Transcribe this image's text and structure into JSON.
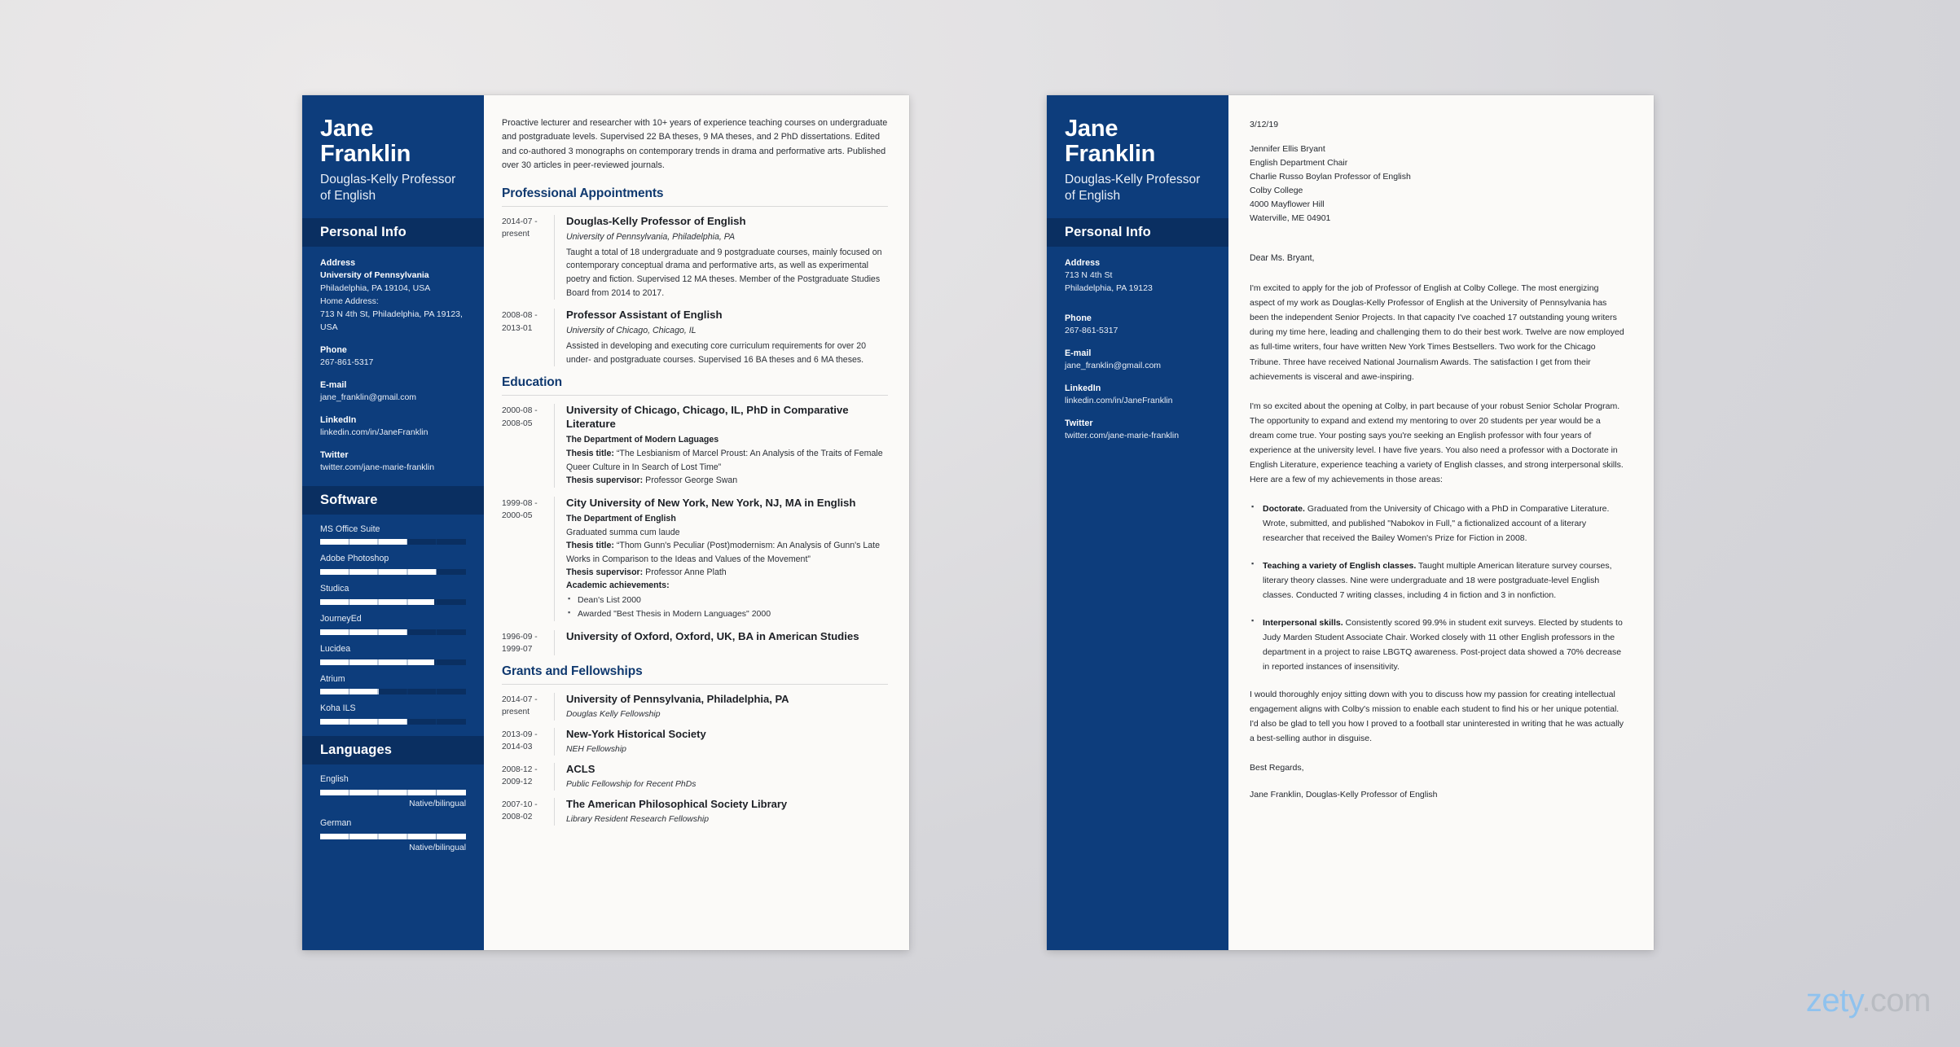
{
  "colors": {
    "sidebar": "#0d3d7c",
    "sidebar_head": "#0a2f61",
    "section_heading": "#10396f",
    "page": "#fbfaf8",
    "backdrop": "#d8d8dc",
    "watermark_accent": "#8fc2ee"
  },
  "resume": {
    "name": "Jane Franklin",
    "name_line1": "Jane",
    "name_line2": "Franklin",
    "job_title": "Douglas-Kelly Professor of English",
    "sections": {
      "personal_info": "Personal Info",
      "software": "Software",
      "languages": "Languages",
      "professional_appointments": "Professional Appointments",
      "education": "Education",
      "grants": "Grants and Fellowships"
    },
    "personal_info": {
      "address_label": "Address",
      "address_org": "University of Pennsylvania",
      "address_city": "Philadelphia, PA 19104, USA",
      "home_address_label": "Home Address:",
      "home_address_line1": "713 N 4th St, Philadelphia, PA 19123,",
      "home_address_line2": "USA",
      "phone_label": "Phone",
      "phone": "267-861-5317",
      "email_label": "E-mail",
      "email": "jane_franklin@gmail.com",
      "linkedin_label": "LinkedIn",
      "linkedin": "linkedin.com/in/JaneFranklin",
      "twitter_label": "Twitter",
      "twitter": "twitter.com/jane-marie-franklin"
    },
    "software": [
      {
        "name": "MS Office Suite",
        "level": 60
      },
      {
        "name": "Adobe Photoshop",
        "level": 80
      },
      {
        "name": "Studica",
        "level": 78
      },
      {
        "name": "JourneyEd",
        "level": 60
      },
      {
        "name": "Lucidea",
        "level": 78
      },
      {
        "name": "Atrium",
        "level": 40
      },
      {
        "name": "Koha ILS",
        "level": 60
      }
    ],
    "languages": [
      {
        "name": "English",
        "level": 100,
        "rating": "Native/bilingual"
      },
      {
        "name": "German",
        "level": 100,
        "rating": "Native/bilingual"
      }
    ],
    "summary": "Proactive lecturer and researcher with 10+ years of experience teaching courses on undergraduate and postgraduate levels. Supervised 22 BA theses, 9 MA theses, and 2 PhD dissertations. Edited and co-authored 3 monographs on contemporary trends in drama and performative arts. Published over 30 articles in peer-reviewed journals.",
    "appointments": [
      {
        "dates": "2014-07 - present",
        "title": "Douglas-Kelly Professor of English",
        "org": "University of Pennsylvania, Philadelphia, PA",
        "desc": "Taught a total of 18 undergraduate and 9 postgraduate courses, mainly focused on contemporary conceptual drama and performative arts, as well as experimental poetry and fiction. Supervised 12 MA theses. Member of the Postgraduate Studies Board from 2014 to 2017."
      },
      {
        "dates": "2008-08 - 2013-01",
        "title": "Professor Assistant of English",
        "org": "University of Chicago, Chicago, IL",
        "desc": "Assisted in developing and executing core curriculum requirements for over 20 under- and postgraduate courses. Supervised 16 BA theses and 6 MA theses."
      }
    ],
    "education": [
      {
        "dates": "2000-08 - 2008-05",
        "title": "University of Chicago, Chicago, IL, PhD in Comparative Literature",
        "department": "The Department of Modern Laguages",
        "thesis_title_label": "Thesis title:",
        "thesis_title": "“The Lesbianism of Marcel Proust: An Analysis of the Traits of Female Queer Culture in In Search of Lost Time”",
        "supervisor_label": "Thesis supervisor:",
        "supervisor": "Professor George Swan"
      },
      {
        "dates": "1999-08 - 2000-05",
        "title": "City University of New York, New York, NJ, MA in English",
        "department": "The Department of English",
        "honors": "Graduated summa cum laude",
        "thesis_title_label": "Thesis title:",
        "thesis_title": "“Thom Gunn's Peculiar (Post)modernism: An Analysis of Gunn's Late Works in Comparison to the Ideas and Values of the Movement”",
        "supervisor_label": "Thesis supervisor:",
        "supervisor": "Professor Anne Plath",
        "achievements_label": "Academic achievements:",
        "achievements": [
          "Dean's List 2000",
          "Awarded \"Best Thesis in Modern Languages\" 2000"
        ]
      },
      {
        "dates": "1996-09 - 1999-07",
        "title": "University of Oxford, Oxford, UK, BA in American Studies"
      }
    ],
    "grants": [
      {
        "dates": "2014-07 - present",
        "title": "University of Pennsylvania, Philadelphia, PA",
        "sub": "Douglas Kelly Fellowship"
      },
      {
        "dates": "2013-09 - 2014-03",
        "title": "New-York Historical Society",
        "sub": "NEH Fellowship"
      },
      {
        "dates": "2008-12 - 2009-12",
        "title": "ACLS",
        "sub": "Public Fellowship for Recent PhDs"
      },
      {
        "dates": "2007-10 - 2008-02",
        "title": "The American Philosophical Society Library",
        "sub": "Library Resident Research Fellowship"
      }
    ]
  },
  "letter": {
    "name_line1": "Jane",
    "name_line2": "Franklin",
    "job_title": "Douglas-Kelly Professor of English",
    "personal_info_heading": "Personal Info",
    "personal_info": {
      "address_label": "Address",
      "address_line1": "713 N 4th St",
      "address_line2": "Philadelphia, PA 19123",
      "phone_label": "Phone",
      "phone": "267-861-5317",
      "email_label": "E-mail",
      "email": "jane_franklin@gmail.com",
      "linkedin_label": "LinkedIn",
      "linkedin": "linkedin.com/in/JaneFranklin",
      "twitter_label": "Twitter",
      "twitter": "twitter.com/jane-marie-franklin"
    },
    "date": "3/12/19",
    "recipient": [
      "Jennifer Ellis Bryant",
      "English Department Chair",
      "Charlie Russo Boylan Professor of English",
      "Colby College",
      "4000 Mayflower Hill",
      "Waterville, ME 04901"
    ],
    "salutation": "Dear Ms. Bryant,",
    "paragraph_1": "I'm excited to apply for the job of Professor of English at Colby College. The most energizing aspect of my work as Douglas-Kelly Professor of English at the University of Pennsylvania has been the independent Senior Projects. In that capacity I've coached 17 outstanding young writers during my time here, leading and challenging them to do their best work. Twelve are now employed as full-time writers, four have written New York Times Bestsellers. Two work for the Chicago Tribune. Three have received National Journalism Awards. The satisfaction I get from their achievements is visceral and awe-inspiring.",
    "paragraph_2": "I'm so excited about the opening at Colby, in part because of your robust Senior Scholar Program. The opportunity to expand and extend my mentoring to over 20 students per year would be a dream come true. Your posting says you're seeking an English professor with four years of experience at the university level. I have five years. You also need a professor with a Doctorate in English Literature, experience teaching a variety of English classes, and strong interpersonal skills. Here are a few of my achievements in those areas:",
    "bullets": [
      {
        "lead": "Doctorate.",
        "text": " Graduated from the University of Chicago with a PhD in Comparative Literature. Wrote, submitted, and published \"Nabokov in Full,\" a fictionalized account of a literary researcher that received the Bailey Women's Prize for Fiction in 2008."
      },
      {
        "lead": "Teaching a variety of English classes.",
        "text": " Taught multiple American literature survey courses, literary theory classes. Nine were undergraduate and 18 were postgraduate-level English classes. Conducted 7 writing classes, including 4 in fiction and 3 in nonfiction."
      },
      {
        "lead": "Interpersonal skills.",
        "text": " Consistently scored 99.9% in student exit surveys. Elected by students to Judy Marden Student Associate Chair. Worked closely with 11 other English professors in the department in a project to raise LBGTQ awareness. Post-project data showed a 70% decrease in reported instances of insensitivity."
      }
    ],
    "paragraph_3": "I would thoroughly enjoy sitting down with you to discuss how my passion for creating intellectual engagement aligns with Colby's mission to enable each student to find his or her unique potential. I'd also be glad to tell you how I proved to a football star uninterested in writing that he was actually a best-selling author in disguise.",
    "closing": "Best Regards,",
    "signature": "Jane Franklin, Douglas-Kelly Professor of English"
  },
  "watermark": {
    "brand": "zety",
    "tld": ".com"
  }
}
